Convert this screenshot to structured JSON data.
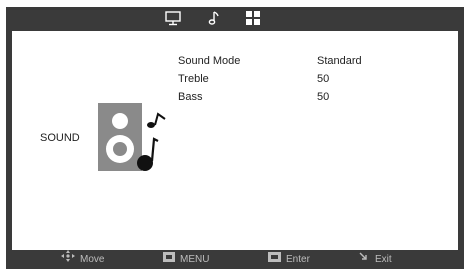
{
  "tabs": [
    {
      "icon": "monitor-icon"
    },
    {
      "icon": "music-note-icon"
    },
    {
      "icon": "grid-icon"
    }
  ],
  "section": {
    "title": "SOUND",
    "icon": "speaker-icon"
  },
  "menu": [
    {
      "label": "Sound Mode",
      "value": "Standard"
    },
    {
      "label": "Treble",
      "value": "50"
    },
    {
      "label": "Bass",
      "value": "50"
    }
  ],
  "hints": [
    {
      "icon": "move-arrows-icon",
      "label": "Move"
    },
    {
      "icon": "menu-key-icon",
      "label": "MENU"
    },
    {
      "icon": "ok-key-icon",
      "label": "Enter"
    },
    {
      "icon": "exit-arrow-icon",
      "label": "Exit"
    }
  ],
  "colors": {
    "frame": "#3a3a3a",
    "panel": "#ffffff",
    "speaker": "#8a8a8a",
    "hint_text": "#bdbdbd"
  }
}
